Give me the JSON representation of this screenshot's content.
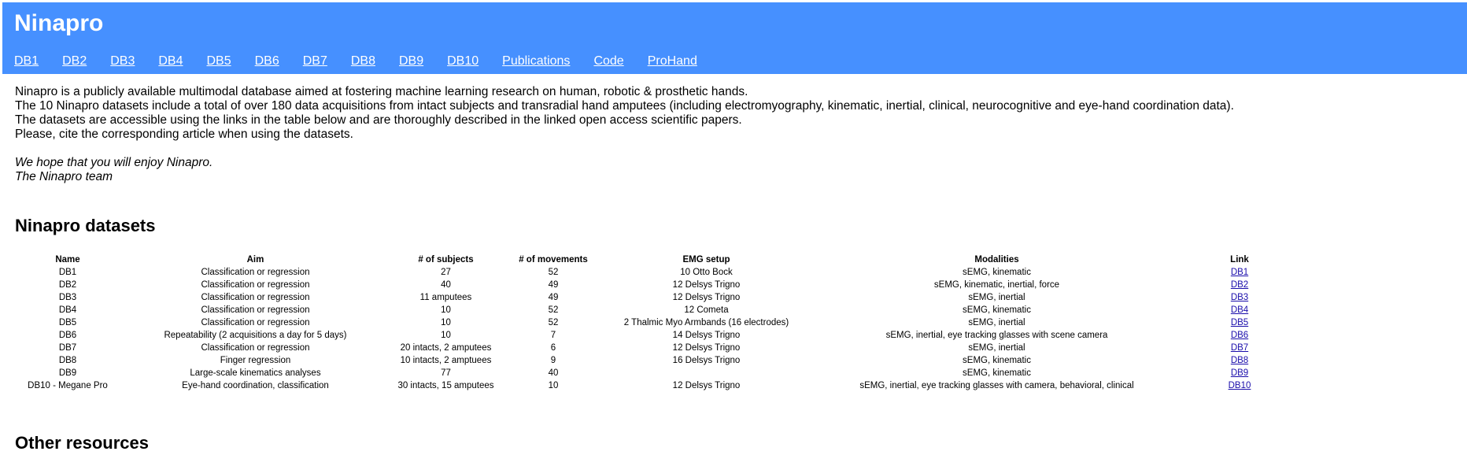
{
  "site": {
    "title": "Ninapro"
  },
  "nav": [
    "DB1",
    "DB2",
    "DB3",
    "DB4",
    "DB5",
    "DB6",
    "DB7",
    "DB8",
    "DB9",
    "DB10",
    "Publications",
    "Code",
    "ProHand"
  ],
  "intro": {
    "lines": [
      "Ninapro is a publicly available multimodal database aimed at fostering machine learning research on human, robotic & prosthetic hands.",
      "The 10 Ninapro datasets include a total of over 180 data acquisitions from intact subjects and transradial hand amputees (including electromyography, kinematic, inertial, clinical, neurocognitive and eye-hand coordination data).",
      "The datasets are accessible using the links in the table below and are thoroughly described in the linked open access scientific papers.",
      "Please, cite the corresponding article when using the datasets."
    ],
    "closing": "We hope that you will enjoy Ninapro.",
    "signature": "The Ninapro team"
  },
  "datasets": {
    "title": "Ninapro datasets",
    "columns": [
      "Name",
      "Aim",
      "# of subjects",
      "# of movements",
      "EMG setup",
      "Modalities",
      "Link"
    ],
    "rows": [
      [
        "DB1",
        "Classification or regression",
        "27",
        "52",
        "10 Otto Bock",
        "sEMG, kinematic",
        "DB1"
      ],
      [
        "DB2",
        "Classification or regression",
        "40",
        "49",
        "12 Delsys Trigno",
        "sEMG, kinematic, inertial, force",
        "DB2"
      ],
      [
        "DB3",
        "Classification or regression",
        "11 amputees",
        "49",
        "12 Delsys Trigno",
        "sEMG, inertial",
        "DB3"
      ],
      [
        "DB4",
        "Classification or regression",
        "10",
        "52",
        "12 Cometa",
        "sEMG, kinematic",
        "DB4"
      ],
      [
        "DB5",
        "Classification or regression",
        "10",
        "52",
        "2 Thalmic Myo Armbands (16 electrodes)",
        "sEMG, inertial",
        "DB5"
      ],
      [
        "DB6",
        "Repeatability (2 acquisitions a day for 5 days)",
        "10",
        "7",
        "14 Delsys Trigno",
        "sEMG, inertial, eye tracking glasses with scene camera",
        "DB6"
      ],
      [
        "DB7",
        "Classification or regression",
        "20 intacts, 2 amputees",
        "6",
        "12 Delsys Trigno",
        "sEMG, inertial",
        "DB7"
      ],
      [
        "DB8",
        "Finger regression",
        "10 intacts, 2 amptuees",
        "9",
        "16 Delsys Trigno",
        "sEMG, kinematic",
        "DB8"
      ],
      [
        "DB9",
        "Large-scale kinematics analyses",
        "77",
        "40",
        "",
        "sEMG, kinematic",
        "DB9"
      ],
      [
        "DB10 - Megane Pro",
        "Eye-hand coordination, classification",
        "30 intacts, 15 amputees",
        "10",
        "12 Delsys Trigno",
        "sEMG, inertial, eye tracking glasses with camera, behavioral, clinical",
        "DB10"
      ]
    ]
  },
  "other": {
    "title": "Other resources"
  },
  "colors": {
    "header": "#4690ff",
    "link": "#1a0dab"
  }
}
